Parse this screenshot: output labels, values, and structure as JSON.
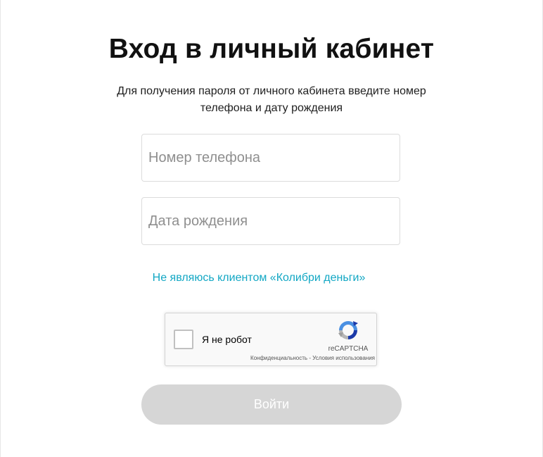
{
  "login": {
    "title": "Вход в личный кабинет",
    "subtitle": "Для получения пароля от личного кабинета введите номер телефона и дату рождения",
    "phone_placeholder": "Номер телефона",
    "phone_value": "",
    "birthdate_placeholder": "Дата рождения",
    "birthdate_value": "",
    "not_client_link": "Не являюсь клиентом «Колибри деньги»",
    "submit_label": "Войти",
    "submit_disabled": true
  },
  "recaptcha": {
    "checkbox_label": "Я не робот",
    "checked": false,
    "brand": "reCAPTCHA",
    "privacy_link": "Конфиденциальность",
    "separator": " - ",
    "terms_link": "Условия использования",
    "icon": "recaptcha-logo-icon"
  },
  "colors": {
    "link": "#12a7c4",
    "button_disabled": "#d6d6d6",
    "title": "#111111"
  }
}
